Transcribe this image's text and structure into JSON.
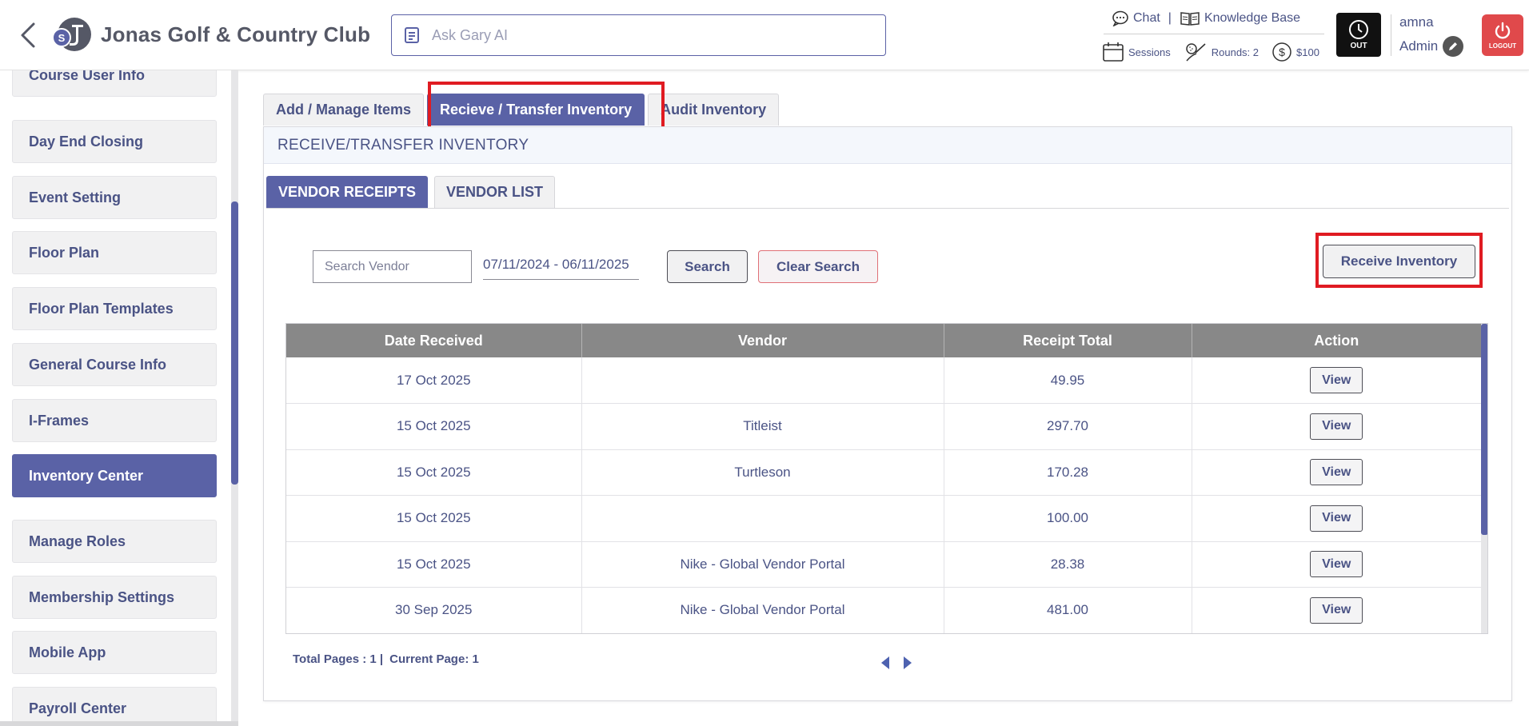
{
  "header": {
    "club_name": "Jonas Golf & Country Club",
    "ask_placeholder": "Ask Gary AI",
    "chat_label": "Chat",
    "separator": "|",
    "knowledge_base_label": "Knowledge Base",
    "sessions_label": "Sessions",
    "rounds_label": "Rounds: 2",
    "balance_label": "$100",
    "out_label": "OUT",
    "user_name": "amna",
    "user_role": "Admin",
    "logout_label": "LOGOUT"
  },
  "sidebar": {
    "items": [
      {
        "label": "Course User Info",
        "active": false
      },
      {
        "label": "Day End Closing",
        "active": false
      },
      {
        "label": "Event Setting",
        "active": false
      },
      {
        "label": "Floor Plan",
        "active": false
      },
      {
        "label": "Floor Plan Templates",
        "active": false
      },
      {
        "label": "General Course Info",
        "active": false
      },
      {
        "label": "I-Frames",
        "active": false
      },
      {
        "label": "Inventory Center",
        "active": true
      },
      {
        "label": "Manage Roles",
        "active": false
      },
      {
        "label": "Membership Settings",
        "active": false
      },
      {
        "label": "Mobile App",
        "active": false
      },
      {
        "label": "Payroll Center",
        "active": false
      }
    ]
  },
  "tabs": [
    {
      "label": "Add / Manage Items",
      "active": false
    },
    {
      "label": "Recieve / Transfer Inventory",
      "active": true
    },
    {
      "label": "Audit Inventory",
      "active": false
    }
  ],
  "panel": {
    "title": "RECEIVE/TRANSFER INVENTORY",
    "subtabs": [
      {
        "label": "VENDOR RECEIPTS",
        "active": true
      },
      {
        "label": "VENDOR LIST",
        "active": false
      }
    ],
    "search_placeholder": "Search Vendor",
    "date_range": "07/11/2024 - 06/11/2025",
    "search_label": "Search",
    "clear_label": "Clear Search",
    "receive_label": "Receive Inventory"
  },
  "table": {
    "columns": [
      "Date Received",
      "Vendor",
      "Receipt Total",
      "Action"
    ],
    "rows": [
      {
        "date": "17 Oct 2025",
        "vendor": "",
        "total": "49.95",
        "action": "View"
      },
      {
        "date": "15 Oct 2025",
        "vendor": "Titleist",
        "total": "297.70",
        "action": "View"
      },
      {
        "date": "15 Oct 2025",
        "vendor": "Turtleson",
        "total": "170.28",
        "action": "View"
      },
      {
        "date": "15 Oct 2025",
        "vendor": "",
        "total": "100.00",
        "action": "View"
      },
      {
        "date": "15 Oct 2025",
        "vendor": "Nike - Global Vendor Portal",
        "total": "28.38",
        "action": "View"
      },
      {
        "date": "30 Sep 2025",
        "vendor": "Nike - Global Vendor Portal",
        "total": "481.00",
        "action": "View"
      }
    ]
  },
  "footer": {
    "total_pages": "Total Pages : 1 |",
    "current_page": "Current Page: 1"
  },
  "colors": {
    "brand": "#5a62a6",
    "text": "#4a5385",
    "highlight": "#e01b22",
    "logout": "#e0494b",
    "table_header": "#888888"
  },
  "icons": {
    "back": "chevron-left-icon",
    "ask": "note-icon",
    "chat": "chat-bubble-icon",
    "knowledge": "book-icon",
    "sessions": "calendar-icon",
    "rounds": "golf-icon",
    "balance": "dollar-circle-icon",
    "out": "clock-icon",
    "edit": "pencil-icon",
    "logout": "power-icon",
    "prev": "triangle-left-icon",
    "next": "triangle-right-icon"
  }
}
